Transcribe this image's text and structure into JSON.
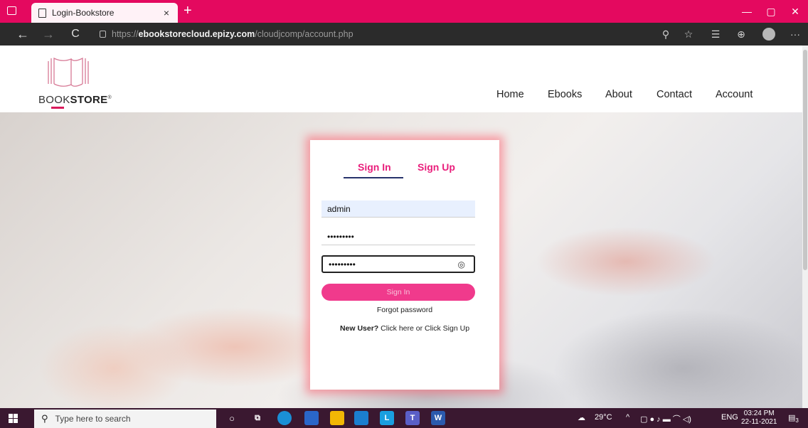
{
  "browser": {
    "tab_title": "Login-Bookstore",
    "tab_close": "×",
    "new_tab": "+",
    "url_scheme": "https://",
    "url_domain": "ebookstorecloud.epizy.com",
    "url_path": "/cloudjcomp/account.php",
    "back": "←",
    "forward": "→",
    "refresh": "C",
    "minimize": "—",
    "restore": "▢",
    "close": "✕",
    "more": "···"
  },
  "site": {
    "logo_prefix": "BOOK",
    "logo_suffix": "STORE",
    "logo_mark": "®",
    "accent": "#e91e7b",
    "nav": [
      "Home",
      "Ebooks",
      "About",
      "Contact",
      "Account"
    ]
  },
  "auth": {
    "tab_signin": "Sign In",
    "tab_signup": "Sign Up",
    "username_value": "admin",
    "password_mask": "•••••••••",
    "confirm_mask": "•••••••••",
    "signin_label": "Sign In",
    "forgot_label": "Forgot password",
    "newuser_prefix": "New User?",
    "newuser_link": "Click here or Click Sign Up"
  },
  "taskbar": {
    "search_placeholder": "Type here to search",
    "weather": "29°C",
    "language": "ENG",
    "time": "03:24 PM",
    "date": "22-11-2021",
    "notifications": "3"
  }
}
